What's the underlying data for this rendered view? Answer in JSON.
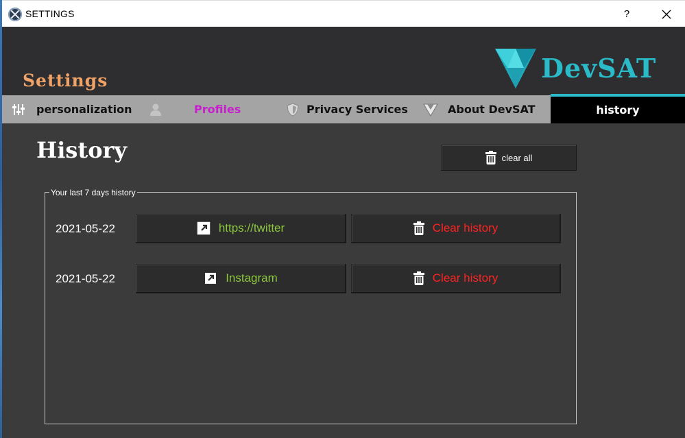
{
  "window": {
    "title": "SETTINGS",
    "help_label": "?",
    "close_icon": "close-icon"
  },
  "header": {
    "section_title": "Settings",
    "brand_name": "DevSAT",
    "brand_color": "#2bbac8",
    "section_title_color": "#f0a368"
  },
  "tabs": [
    {
      "label": "personalization",
      "icon": "sliders-icon"
    },
    {
      "label": "Profiles",
      "icon": "user-icon",
      "color": "#c81ed0"
    },
    {
      "label": "Privacy Services",
      "icon": "shield-icon"
    },
    {
      "label": "About DevSAT",
      "icon": "logo-icon"
    },
    {
      "label": "history",
      "active": true
    }
  ],
  "main": {
    "heading": "History",
    "clear_all_label": "clear all",
    "group_label": "Your last 7 days history",
    "rows": [
      {
        "date": "2021-05-22",
        "link_label": "https://twitter",
        "clear_label": "Clear history"
      },
      {
        "date": "2021-05-22",
        "link_label": "Instagram",
        "clear_label": "Clear history"
      }
    ],
    "link_color": "#8bc63f",
    "clear_color": "#ff2222"
  }
}
